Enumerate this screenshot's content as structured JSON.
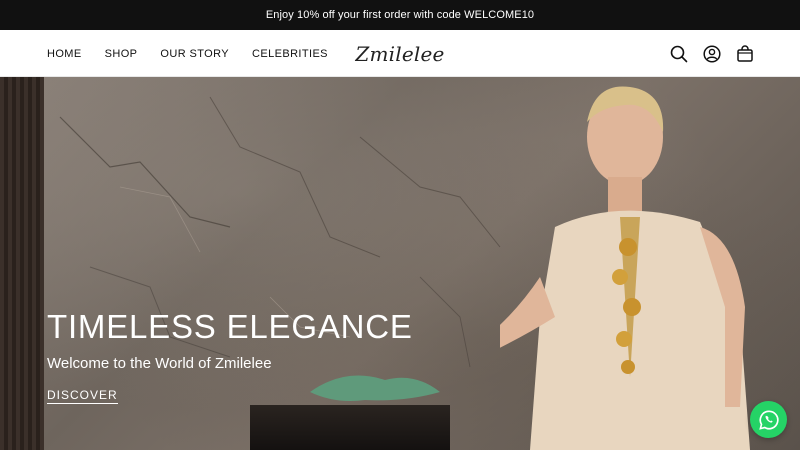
{
  "announcement": {
    "text": "Enjoy 10% off your first order with code WELCOME10"
  },
  "header": {
    "nav": [
      {
        "label": "HOME"
      },
      {
        "label": "SHOP"
      },
      {
        "label": "OUR STORY"
      },
      {
        "label": "CELEBRITIES"
      }
    ],
    "logo": "Zmilelee",
    "icons": [
      "search-icon",
      "account-icon",
      "cart-icon"
    ]
  },
  "hero": {
    "title": "TIMELESS ELEGANCE",
    "subtitle": "Welcome to the World of Zmilelee",
    "cta": "DISCOVER"
  },
  "whatsapp": {
    "icon": "whatsapp-icon",
    "color": "#25d366"
  },
  "colors": {
    "announcement_bg": "#111111",
    "header_bg": "#ffffff",
    "text": "#111111"
  }
}
